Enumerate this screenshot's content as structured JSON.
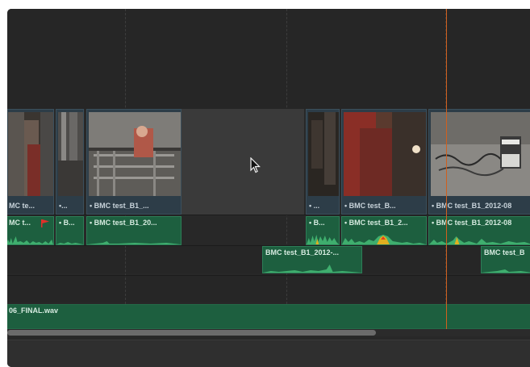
{
  "timeline": {
    "video_track": {
      "clips": [
        {
          "label": "MC te..."
        },
        {
          "label": "•..."
        },
        {
          "label": "• BMC test_B1_..."
        },
        {
          "label": "• ..."
        },
        {
          "label": "• BMC test_B..."
        },
        {
          "label": "• BMC test_B1_2012-08"
        }
      ]
    },
    "audio_track_1": {
      "clips": [
        {
          "label": "MC t..."
        },
        {
          "label": "• B..."
        },
        {
          "label": "• BMC test_B1_20..."
        },
        {
          "label": "• B..."
        },
        {
          "label": "• BMC test_B1_2..."
        },
        {
          "label": "• BMC test_B1_2012-08"
        }
      ]
    },
    "audio_track_2": {
      "clips": [
        {
          "label": "BMC test_B1_2012-..."
        },
        {
          "label": "BMC test_B"
        }
      ]
    },
    "music_track": {
      "label": "06_FINAL.wav"
    }
  },
  "colors": {
    "playhead": "#d0601e",
    "audio_clip": "#1d5f3f",
    "video_clip": "#2d3d48",
    "marker_flag": "#e0302a"
  },
  "icons": {
    "marker": "red-flag-icon",
    "cursor": "mouse-pointer-icon"
  }
}
